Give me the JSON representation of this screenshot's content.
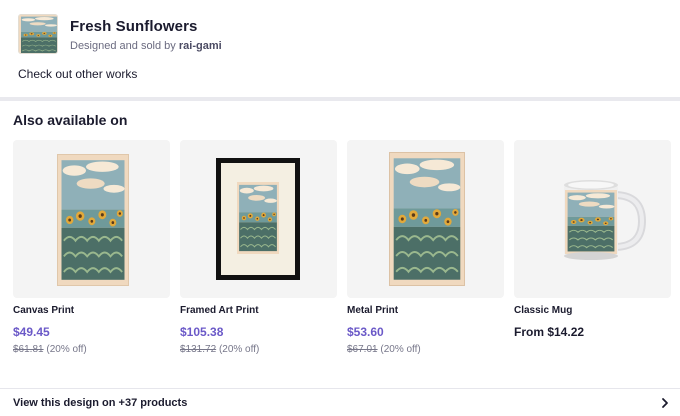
{
  "header": {
    "title": "Fresh Sunflowers",
    "byline_prefix": "Designed and sold by ",
    "artist": "rai-gami",
    "other_works_link": "Check out other works"
  },
  "section": {
    "title": "Also available on"
  },
  "products": [
    {
      "name": "Canvas Print",
      "price": "$49.45",
      "original_price": "$61.81",
      "discount": "(20% off)"
    },
    {
      "name": "Framed Art Print",
      "price": "$105.38",
      "original_price": "$131.72",
      "discount": "(20% off)"
    },
    {
      "name": "Metal Print",
      "price": "$53.60",
      "original_price": "$67.01",
      "discount": "(20% off)"
    },
    {
      "name": "Classic Mug",
      "price": "From $14.22"
    }
  ],
  "footer": {
    "link": "View this design on +37 products",
    "icon": "chevron-right-icon"
  },
  "colors": {
    "accent_price": "#6b59c8",
    "text": "#1b1b2e",
    "muted": "#77778a"
  }
}
